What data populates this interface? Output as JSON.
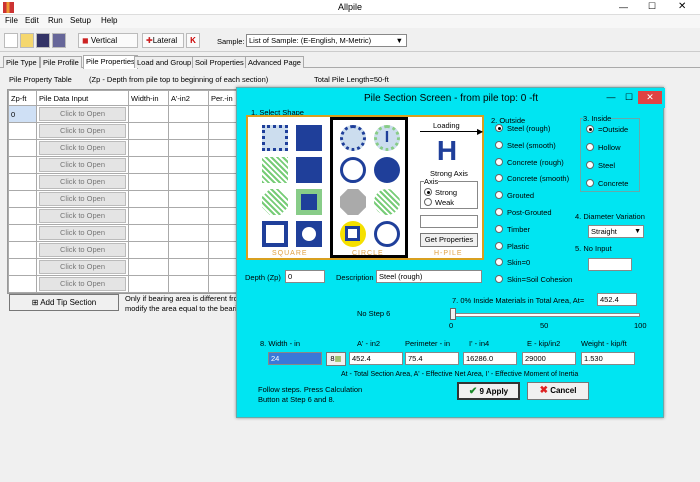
{
  "window": {
    "title": "Allpile"
  },
  "menu": [
    "File",
    "Edit",
    "Run",
    "Setup",
    "Help"
  ],
  "toolbar": {
    "vertical": "Vertical",
    "lateral": "Lateral",
    "k": "K",
    "sample_label": "Sample:",
    "sample_value": "List of Sample:  (E-English, M-Metric)"
  },
  "tabs": [
    "Pile Type",
    "Pile Profile",
    "Pile Properties",
    "Load and Group",
    "Soil Properties",
    "Advanced Page"
  ],
  "info": {
    "table_label": "Pile Property Table",
    "zp_note": "(Zp - Depth from pile top to beginning of each section)",
    "total_length": "Total Pile Length=50-ft"
  },
  "grid": {
    "headers": [
      "Zp-ft",
      "Pile Data Input",
      "Width-in",
      "A'-in2",
      "Per.-in"
    ],
    "first_zp": "0",
    "click_label": "Click to Open",
    "rows": 11
  },
  "tip": {
    "button": "Add Tip Section",
    "note1": "Only if bearing area is different from",
    "note2": "modify the area equal to the bearin"
  },
  "dialog": {
    "title": "Pile Section Screen - from pile top: 0 -ft",
    "select_shape": "1. Select Shape",
    "square": "SQUARE",
    "circle": "CIRCLE",
    "hpile": "H-PILE",
    "loading": "Loading",
    "strong_axis": "Strong Axis",
    "axis": "Axis",
    "strong": "Strong",
    "weak": "Weak",
    "get_props": "Get Properties",
    "depth_label": "Depth (Zp)",
    "depth_value": "0",
    "desc_label": "Description",
    "desc_value": "Steel (rough)",
    "outside_title": "2. Outside",
    "outside": [
      "Steel (rough)",
      "Steel (smooth)",
      "Concrete (rough)",
      "Concrete (smooth)",
      "Grouted",
      "Post-Grouted",
      "Timber",
      "Plastic",
      "Skin=0",
      "Skin=Soil Cohesion"
    ],
    "inside_title": "3. Inside",
    "inside": [
      "=Outside",
      "Hollow",
      "Steel",
      "Concrete"
    ],
    "diam_title": "4.  Diameter Variation",
    "diam_value": "Straight",
    "no_input_title": "5. No Input",
    "step6": "No Step 6",
    "step7_label": "7.  0% Inside Materials in Total Area, At=",
    "step7_value": "452.4",
    "slider_ticks": [
      "0",
      "50",
      "100"
    ],
    "slider_percent": 0,
    "step8_label": "8.  Width - in",
    "step8_btn": "8",
    "col_labels": [
      "A' - in2",
      "Perimeter - in",
      "I' - in4",
      "E - kip/in2",
      "Weight - kip/ft"
    ],
    "col_values": [
      "452.4",
      "75.4",
      "16286.0",
      "29000",
      "1.530"
    ],
    "width_value": "24",
    "legend": "At - Total Section Area,  A' - Effective Net Area, I' - Effective Moment of Inertia",
    "follow1": "Follow steps.  Press Calculation",
    "follow2": "Button at Step 6 and 8.",
    "apply": "Apply",
    "apply_num": "9",
    "cancel": "Cancel"
  }
}
